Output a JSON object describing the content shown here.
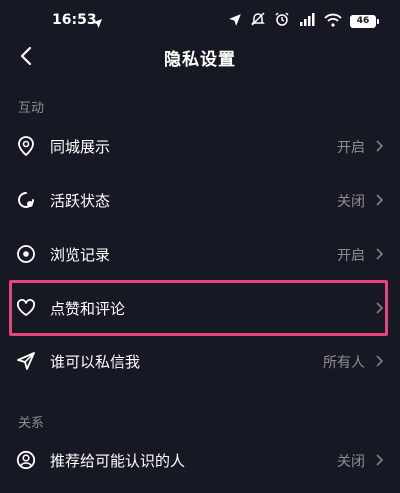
{
  "status_bar": {
    "time": "16:53",
    "battery": "46"
  },
  "header": {
    "title": "隐私设置"
  },
  "sections": [
    {
      "header": "互动"
    },
    {
      "header": "关系"
    }
  ],
  "rows": [
    {
      "label": "同城展示",
      "value": "开启",
      "icon": "location-pin-icon"
    },
    {
      "label": "活跃状态",
      "value": "关闭",
      "icon": "active-status-icon"
    },
    {
      "label": "浏览记录",
      "value": "开启",
      "icon": "eye-icon"
    },
    {
      "label": "点赞和评论",
      "value": "",
      "icon": "heart-icon"
    },
    {
      "label": "谁可以私信我",
      "value": "所有人",
      "icon": "send-icon"
    },
    {
      "label": "推荐给可能认识的人",
      "value": "关闭",
      "icon": "user-circle-icon"
    }
  ],
  "colors": {
    "background": "#161823",
    "highlight": "#e8457a"
  }
}
